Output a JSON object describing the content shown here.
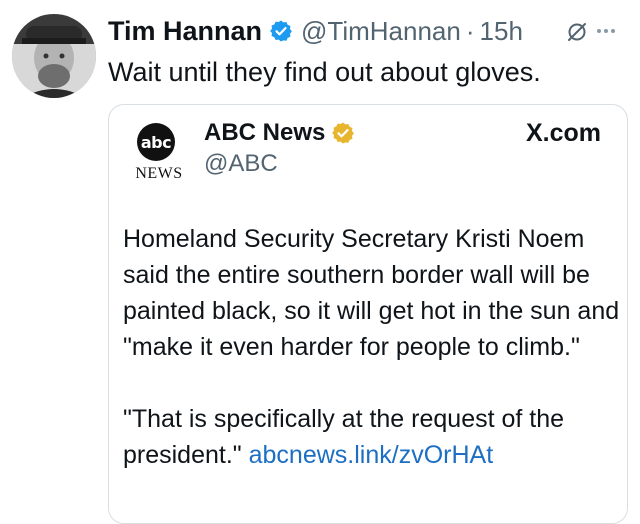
{
  "tweet": {
    "author_name": "Tim Hannan",
    "author_handle": "@TimHannan",
    "separator": "·",
    "time": "15h",
    "text": "Wait until they find out about gloves."
  },
  "quote": {
    "author_name": "ABC News",
    "author_handle": "@ABC",
    "source_label": "X.com",
    "logo_text": "abc",
    "logo_subtext": "NEWS",
    "paragraph_1": "Homeland Security Secretary Kristi Noem said the entire southern border wall will be painted black, so it will get hot in the sun and \"make it even harder for people to climb.\"",
    "paragraph_2_text": "\"That is specifically at the request of the president.\"",
    "paragraph_2_link": "abcnews.link/zvOrHAt"
  },
  "icons": {
    "verified": "verified-badge-icon",
    "gold_verified": "gold-verified-badge-icon",
    "grok": "grok-icon",
    "more": "more-icon"
  },
  "colors": {
    "verified_blue": "#1d9bf0",
    "verified_gold": "#e8b52f",
    "link_blue": "#1d6fc4",
    "secondary_text": "#536471"
  }
}
